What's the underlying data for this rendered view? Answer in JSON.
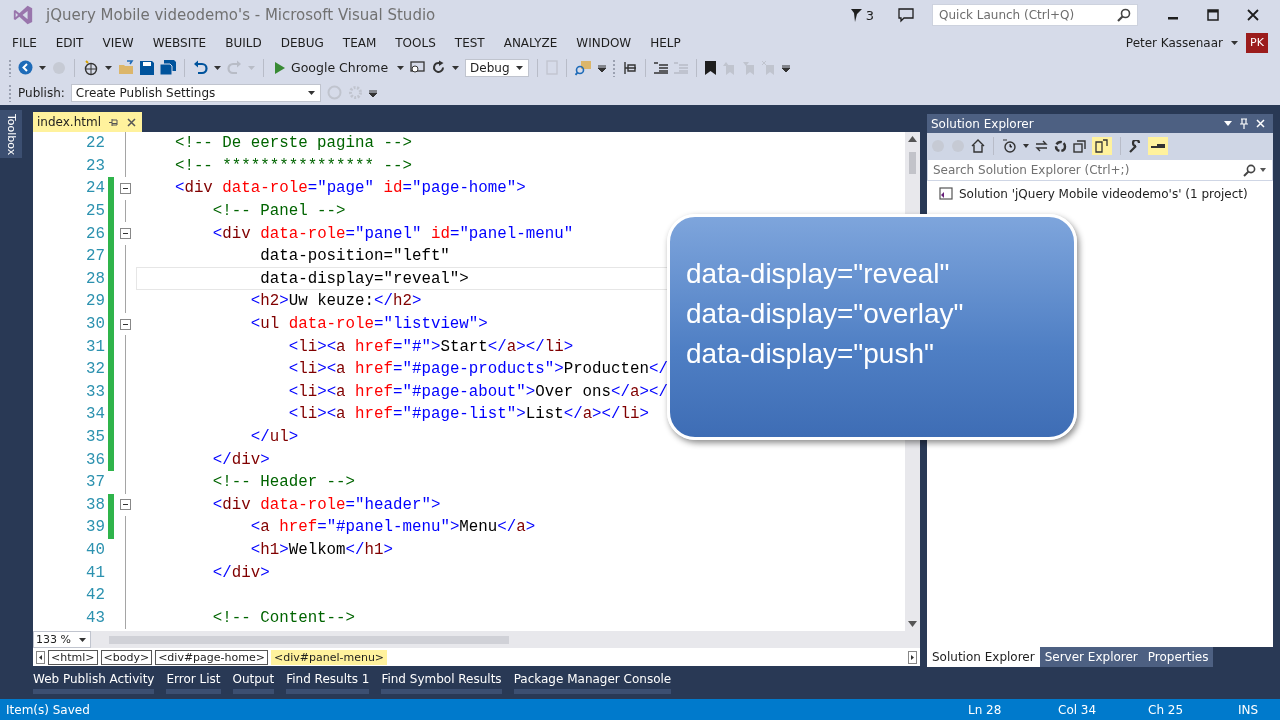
{
  "window": {
    "title": "jQuery Mobile videodemo's - Microsoft Visual Studio",
    "notification_count": "3",
    "quick_launch": {
      "placeholder": "Quick Launch (Ctrl+Q)"
    }
  },
  "menu": [
    "FILE",
    "EDIT",
    "VIEW",
    "WEBSITE",
    "BUILD",
    "DEBUG",
    "TEAM",
    "TOOLS",
    "TEST",
    "ANALYZE",
    "WINDOW",
    "HELP"
  ],
  "account": {
    "name": "Peter Kassenaar",
    "initials": "PK"
  },
  "toolbar": {
    "browser": "Google Chrome",
    "configuration": "Debug"
  },
  "publish_bar": {
    "label": "Publish:",
    "value": "Create Publish Settings"
  },
  "toolbox": {
    "label": "Toolbox"
  },
  "editor": {
    "tab": {
      "title": "index.html"
    },
    "lines": [
      {
        "number": "22",
        "text": "    <!-- De eerste pagina -->",
        "changed": false,
        "fold": false,
        "current": false
      },
      {
        "number": "23",
        "text": "    <!-- **************** -->",
        "changed": false,
        "fold": false,
        "current": false
      },
      {
        "number": "24",
        "text": "    <div data-role=\"page\" id=\"page-home\">",
        "changed": true,
        "fold": true,
        "current": false
      },
      {
        "number": "25",
        "text": "        <!-- Panel -->",
        "changed": true,
        "fold": false,
        "current": false
      },
      {
        "number": "26",
        "text": "        <div data-role=\"panel\" id=\"panel-menu\"",
        "changed": true,
        "fold": true,
        "current": false
      },
      {
        "number": "27",
        "text": "             data-position=\"left\"",
        "changed": true,
        "fold": false,
        "current": false
      },
      {
        "number": "28",
        "text": "             data-display=\"reveal\">",
        "changed": true,
        "fold": false,
        "current": true
      },
      {
        "number": "29",
        "text": "            <h2>Uw keuze:</h2>",
        "changed": true,
        "fold": false,
        "current": false
      },
      {
        "number": "30",
        "text": "            <ul data-role=\"listview\">",
        "changed": true,
        "fold": true,
        "current": false
      },
      {
        "number": "31",
        "text": "                <li><a href=\"#\">Start</a></li>",
        "changed": true,
        "fold": false,
        "current": false
      },
      {
        "number": "32",
        "text": "                <li><a href=\"#page-products\">Producten</",
        "changed": true,
        "fold": false,
        "current": false
      },
      {
        "number": "33",
        "text": "                <li><a href=\"#page-about\">Over ons</a></",
        "changed": true,
        "fold": false,
        "current": false
      },
      {
        "number": "34",
        "text": "                <li><a href=\"#page-list\">List</a></li>",
        "changed": true,
        "fold": false,
        "current": false
      },
      {
        "number": "35",
        "text": "            </ul>",
        "changed": true,
        "fold": false,
        "current": false
      },
      {
        "number": "36",
        "text": "        </div>",
        "changed": true,
        "fold": false,
        "current": false
      },
      {
        "number": "37",
        "text": "        <!-- Header -->",
        "changed": false,
        "fold": false,
        "current": false
      },
      {
        "number": "38",
        "text": "        <div data-role=\"header\">",
        "changed": true,
        "fold": true,
        "current": false
      },
      {
        "number": "39",
        "text": "            <a href=\"#panel-menu\">Menu</a>",
        "changed": true,
        "fold": false,
        "current": false
      },
      {
        "number": "40",
        "text": "            <h1>Welkom</h1>",
        "changed": false,
        "fold": false,
        "current": false
      },
      {
        "number": "41",
        "text": "        </div>",
        "changed": false,
        "fold": false,
        "current": false
      },
      {
        "number": "42",
        "changed": false,
        "fold": false,
        "current": false
      },
      {
        "number": "43",
        "text": "        <!-- Content-->",
        "changed": false,
        "fold": false,
        "current": false
      }
    ],
    "zoom": "133 %",
    "breadcrumbs": [
      {
        "label": "<html>",
        "selected": false
      },
      {
        "label": "<body>",
        "selected": false
      },
      {
        "label": "<div#page-home>",
        "selected": false
      },
      {
        "label": "<div#panel-menu>",
        "selected": true
      }
    ]
  },
  "callout": {
    "lines": [
      "data-display=\"reveal\"",
      "data-display=\"overlay\"",
      "data-display=\"push\""
    ]
  },
  "solution_explorer": {
    "title": "Solution Explorer",
    "search": {
      "placeholder": "Search Solution Explorer (Ctrl+;)"
    },
    "root": "Solution 'jQuery Mobile videodemo's' (1 project)",
    "tabs": [
      {
        "label": "Solution Explorer",
        "selected": true
      },
      {
        "label": "Server Explorer",
        "selected": false
      },
      {
        "label": "Properties",
        "selected": false
      }
    ]
  },
  "tool_tabs": [
    "Web Publish Activity",
    "Error List",
    "Output",
    "Find Results 1",
    "Find Symbol Results",
    "Package Manager Console"
  ],
  "status_bar": {
    "message": "Item(s) Saved",
    "line": "Ln 28",
    "column": "Col 34",
    "char": "Ch 25",
    "mode": "INS"
  }
}
